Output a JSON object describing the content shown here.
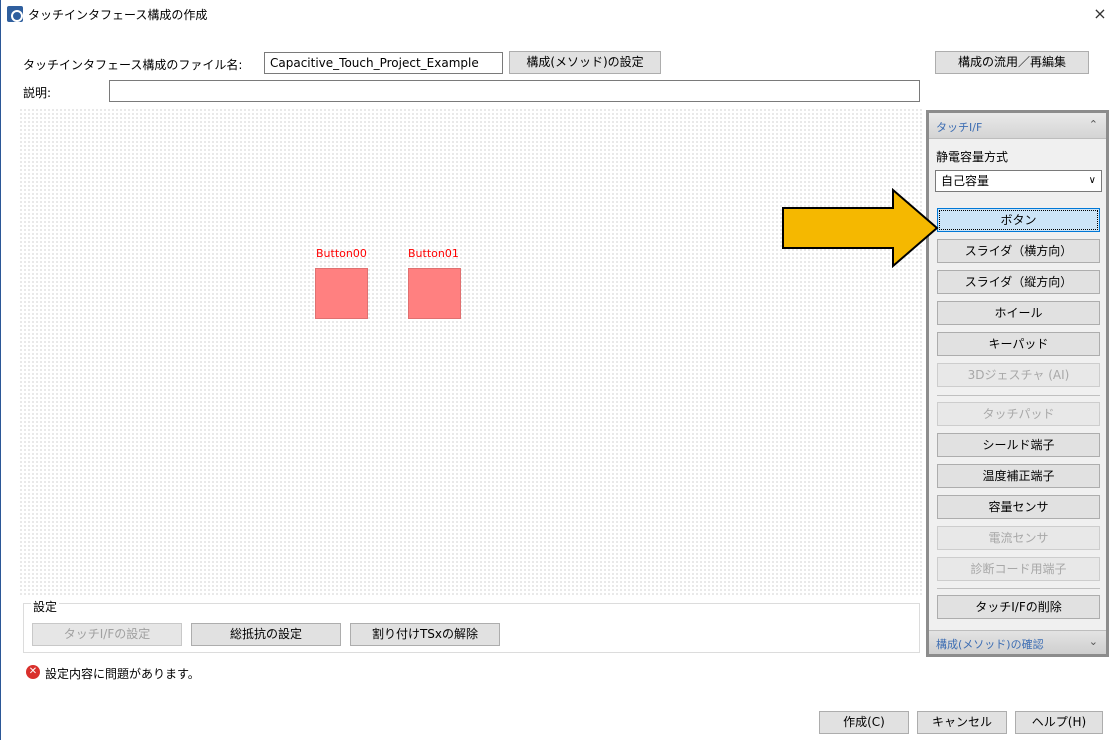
{
  "window": {
    "title": "タッチインタフェース構成の作成",
    "close_label": "×"
  },
  "form": {
    "filename_label": "タッチインタフェース構成のファイル名:",
    "filename_value": "Capacitive_Touch_Project_Example",
    "method_settings_button": "構成(メソッド)の設定",
    "reuse_button": "構成の流用／再編集",
    "description_label": "説明:",
    "description_value": ""
  },
  "canvas": {
    "buttons": [
      {
        "label": "Button00"
      },
      {
        "label": "Button01"
      }
    ]
  },
  "settings": {
    "legend": "設定",
    "touch_if_settings": "タッチI/Fの設定",
    "total_resistance": "総抵抗の設定",
    "unassign_tsx": "割り付けTSxの解除"
  },
  "status": {
    "error_text": "設定内容に問題があります。"
  },
  "panel": {
    "header": "タッチI/F",
    "method_label": "静電容量方式",
    "method_value": "自己容量",
    "buttons": [
      {
        "label": "ボタン",
        "state": "selected"
      },
      {
        "label": "スライダ（横方向）",
        "state": "enabled"
      },
      {
        "label": "スライダ（縦方向）",
        "state": "enabled"
      },
      {
        "label": "ホイール",
        "state": "enabled"
      },
      {
        "label": "キーパッド",
        "state": "enabled"
      },
      {
        "label": "3Dジェスチャ (AI)",
        "state": "disabled"
      },
      {
        "label": "タッチパッド",
        "state": "disabled"
      },
      {
        "label": "シールド端子",
        "state": "enabled"
      },
      {
        "label": "温度補正端子",
        "state": "enabled"
      },
      {
        "label": "容量センサ",
        "state": "enabled"
      },
      {
        "label": "電流センサ",
        "state": "disabled"
      },
      {
        "label": "診断コード用端子",
        "state": "disabled"
      },
      {
        "label": "タッチI/Fの削除",
        "state": "enabled"
      }
    ],
    "footer": "構成(メソッド)の確認"
  },
  "footer": {
    "create_button": "作成(C)",
    "cancel_button": "キャンセル",
    "help_button": "ヘルプ(H)"
  },
  "colors": {
    "arrow_fill": "#f5b800",
    "touch_button": "#ff8080",
    "touch_label": "#ff0000",
    "panel_header_text": "#3c6db3"
  }
}
